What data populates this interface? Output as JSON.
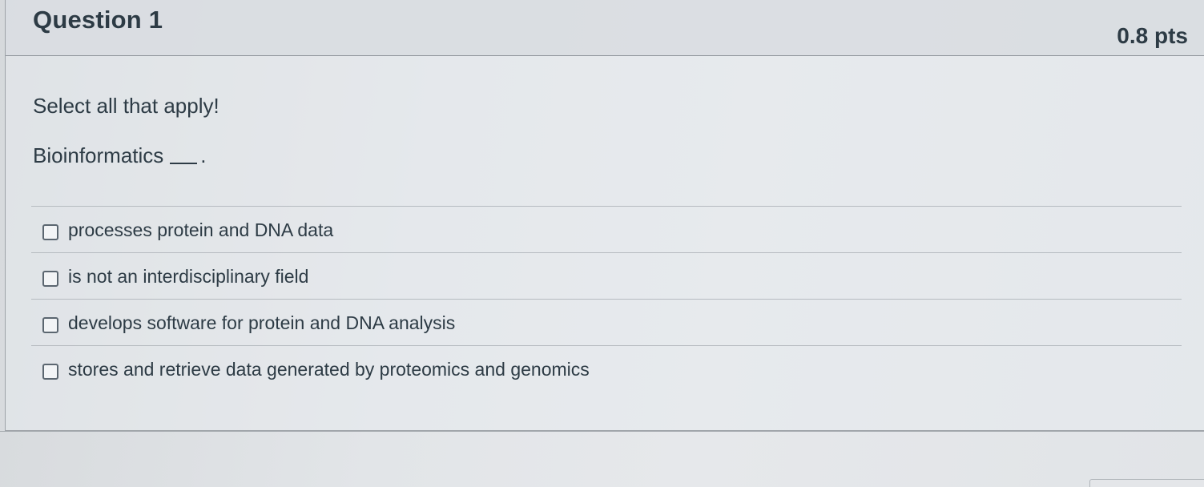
{
  "question": {
    "title": "Question 1",
    "points": "0.8 pts",
    "instruction": "Select all that apply!",
    "stem": "Bioinformatics",
    "stem_suffix": "."
  },
  "answers": [
    {
      "label": "processes protein and DNA data",
      "checked": false
    },
    {
      "label": "is not an interdisciplinary field",
      "checked": false
    },
    {
      "label": "develops software for protein and DNA analysis",
      "checked": false
    },
    {
      "label": "stores and retrieve data generated by proteomics and genomics",
      "checked": false
    }
  ]
}
